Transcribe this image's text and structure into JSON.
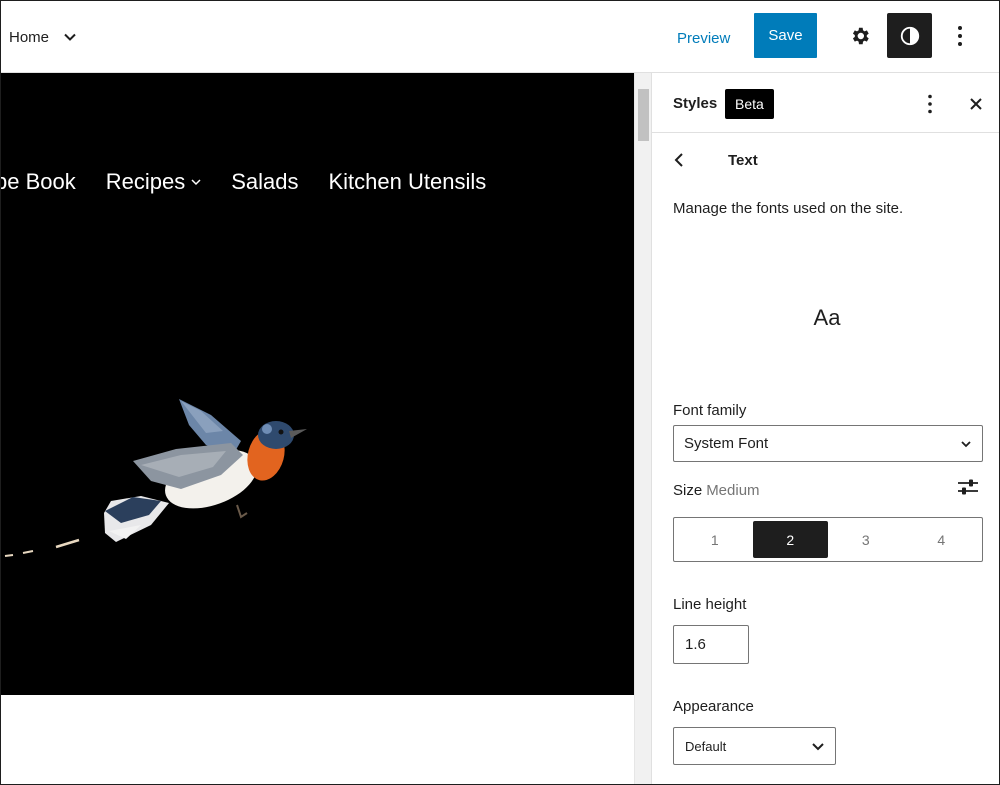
{
  "topbar": {
    "document_title": "Home",
    "preview_label": "Preview",
    "save_label": "Save"
  },
  "canvas": {
    "nav_items": [
      {
        "label": "pe Book"
      },
      {
        "label": "Recipes",
        "has_submenu": true
      },
      {
        "label": "Salads"
      },
      {
        "label": "Kitchen Utensils"
      }
    ],
    "hero_background": "#000000"
  },
  "sidebar": {
    "title": "Styles",
    "badge": "Beta",
    "panel_title": "Text",
    "description": "Manage the fonts used on the site.",
    "preview_text": "Aa",
    "font_family": {
      "label": "Font family",
      "value": "System Font"
    },
    "size": {
      "label": "Size",
      "value": "Medium",
      "options": [
        "1",
        "2",
        "3",
        "4"
      ],
      "selected_index": 1
    },
    "line_height": {
      "label": "Line height",
      "value": "1.6"
    },
    "appearance": {
      "label": "Appearance",
      "value": "Default"
    }
  },
  "colors": {
    "accent": "#007cba",
    "dark": "#1e1e1e",
    "muted": "#757575"
  }
}
